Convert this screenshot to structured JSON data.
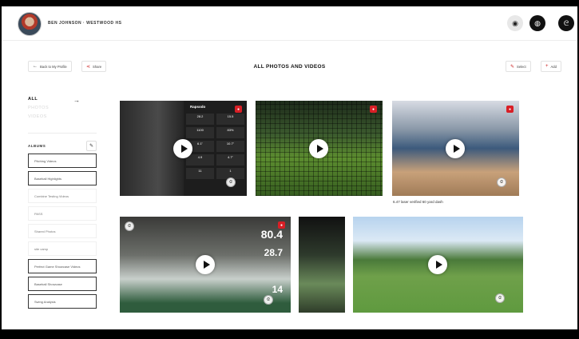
{
  "header": {
    "user_name": "BEN JOHNSON · WESTWOOD HS"
  },
  "toolbar": {
    "back_label": "Back to My Profile",
    "share_label": "Share",
    "select_label": "Select",
    "add_label": "Add"
  },
  "main": {
    "title": "ALL PHOTOS AND VIDEOS"
  },
  "sidebar": {
    "filters": [
      {
        "label": "ALL",
        "active": true
      },
      {
        "label": "PHOTOS",
        "active": false
      },
      {
        "label": "VIDEOS",
        "active": false
      }
    ],
    "albums_label": "ALBUMS",
    "albums": [
      {
        "label": "Pitching Videos",
        "bordered": true
      },
      {
        "label": "Baseball Highlights",
        "bordered": true
      },
      {
        "label": "Combine Testing Videos",
        "bordered": false
      },
      {
        "label": "PASS",
        "bordered": false
      },
      {
        "label": "Shared Photos",
        "bordered": false
      },
      {
        "label": "site camp",
        "bordered": false
      },
      {
        "label": "Perfect Game Showcase Videos",
        "bordered": true
      },
      {
        "label": "Baseball Showcase",
        "bordered": true
      },
      {
        "label": "Swing Analysis",
        "bordered": true
      }
    ]
  },
  "media": {
    "tile1": {
      "brand": "Rapsodo",
      "stats": [
        "28.2",
        "15.5",
        "1100",
        "83%",
        "6.1\"",
        "10.7\"",
        "4.9",
        "4.7\"",
        "11",
        "1"
      ]
    },
    "tile3": {
      "caption": "6.47 laser verified 60 yard dash"
    },
    "tile4": {
      "stats": [
        "80.4",
        "28.7",
        "14"
      ]
    }
  },
  "colors": {
    "accent_red": "#d81f26",
    "dark": "#111111"
  }
}
